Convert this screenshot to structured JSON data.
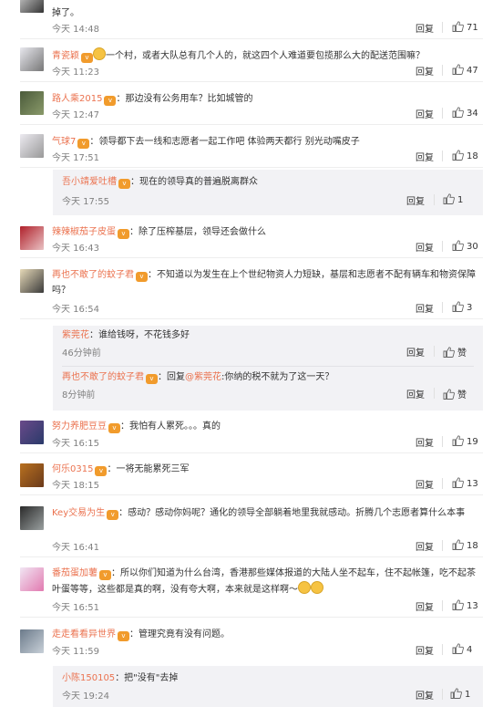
{
  "labels": {
    "reply": "回复"
  },
  "comments": [
    {
      "text": "掉了。",
      "time": "今天 14:48",
      "likes": "71"
    },
    {
      "name": "青瓷颖",
      "text": "一个村，或者大队总有几个人的，就这四个人难道要包揽那么大的配送范围嘛？",
      "time": "今天 11:23",
      "likes": "47"
    },
    {
      "name": "路人乘2015",
      "text": "：那边没有公务用车？比如城管的",
      "time": "今天 12:47",
      "likes": "34"
    },
    {
      "name": "气球7",
      "text": "：领导都下去一线和志愿者一起工作吧 体验两天都行 别光动嘴皮子",
      "time": "今天 17:51",
      "likes": "18"
    },
    {
      "name": "辣辣椒茄子皮蛋",
      "text": "：除了压榨基层，领导还会做什么",
      "time": "今天 16:43",
      "likes": "30"
    },
    {
      "name": "再也不敢了的蚊子君",
      "text": "：不知道以为发生在上个世纪物资人力短缺，基层和志愿者不配有辆车和物资保障吗？",
      "time": "今天 16:54",
      "likes": "3"
    },
    {
      "name": "努力养肥豆豆",
      "text": "：我怕有人累死。。。真的",
      "time": "今天 16:15",
      "likes": "19"
    },
    {
      "name": "何乐0315",
      "text": "：一将无能累死三军",
      "time": "今天 18:15",
      "likes": "13"
    },
    {
      "name": "Key交易为生",
      "text": "：感动？感动你妈呢？通化的领导全部躺着地里我就感动。折腾几个志愿者算什么本事",
      "time": "今天 16:41",
      "likes": "18"
    },
    {
      "name": "番茄蛋加薯",
      "text": "：所以你们知道为什么台湾，香港那些媒体报道的大陆人坐不起车，住不起帐篷，吃不起茶叶蛋等等，这些都是真的啊，没有夸大啊，本来就是这样啊～",
      "time": "今天 16:51",
      "likes": "13"
    },
    {
      "name": "走走看看异世界",
      "text": "：管理究竟有没有问题。",
      "time": "今天 11:59",
      "likes": "4"
    }
  ],
  "subreplies": [
    {
      "name": "吾小靖爱吐槽",
      "text": "：现在的领导真的普遍脱离群众",
      "time": "今天 17:55",
      "likes": "1"
    },
    {
      "name": "紫莞花",
      "text": "：谁给钱呀，不花钱多好",
      "time": "46分钟前",
      "likes": "赞"
    },
    {
      "name": "再也不敢了的蚊子君",
      "text": "：回复",
      "mention": "@紫莞花",
      "text2": ":你纳的税不就为了这一天？",
      "time": "8分钟前",
      "likes": "赞"
    },
    {
      "name": "小陈150105",
      "text": "：把\"没有\"去掉",
      "time": "今天 19:24",
      "likes": "1"
    }
  ]
}
